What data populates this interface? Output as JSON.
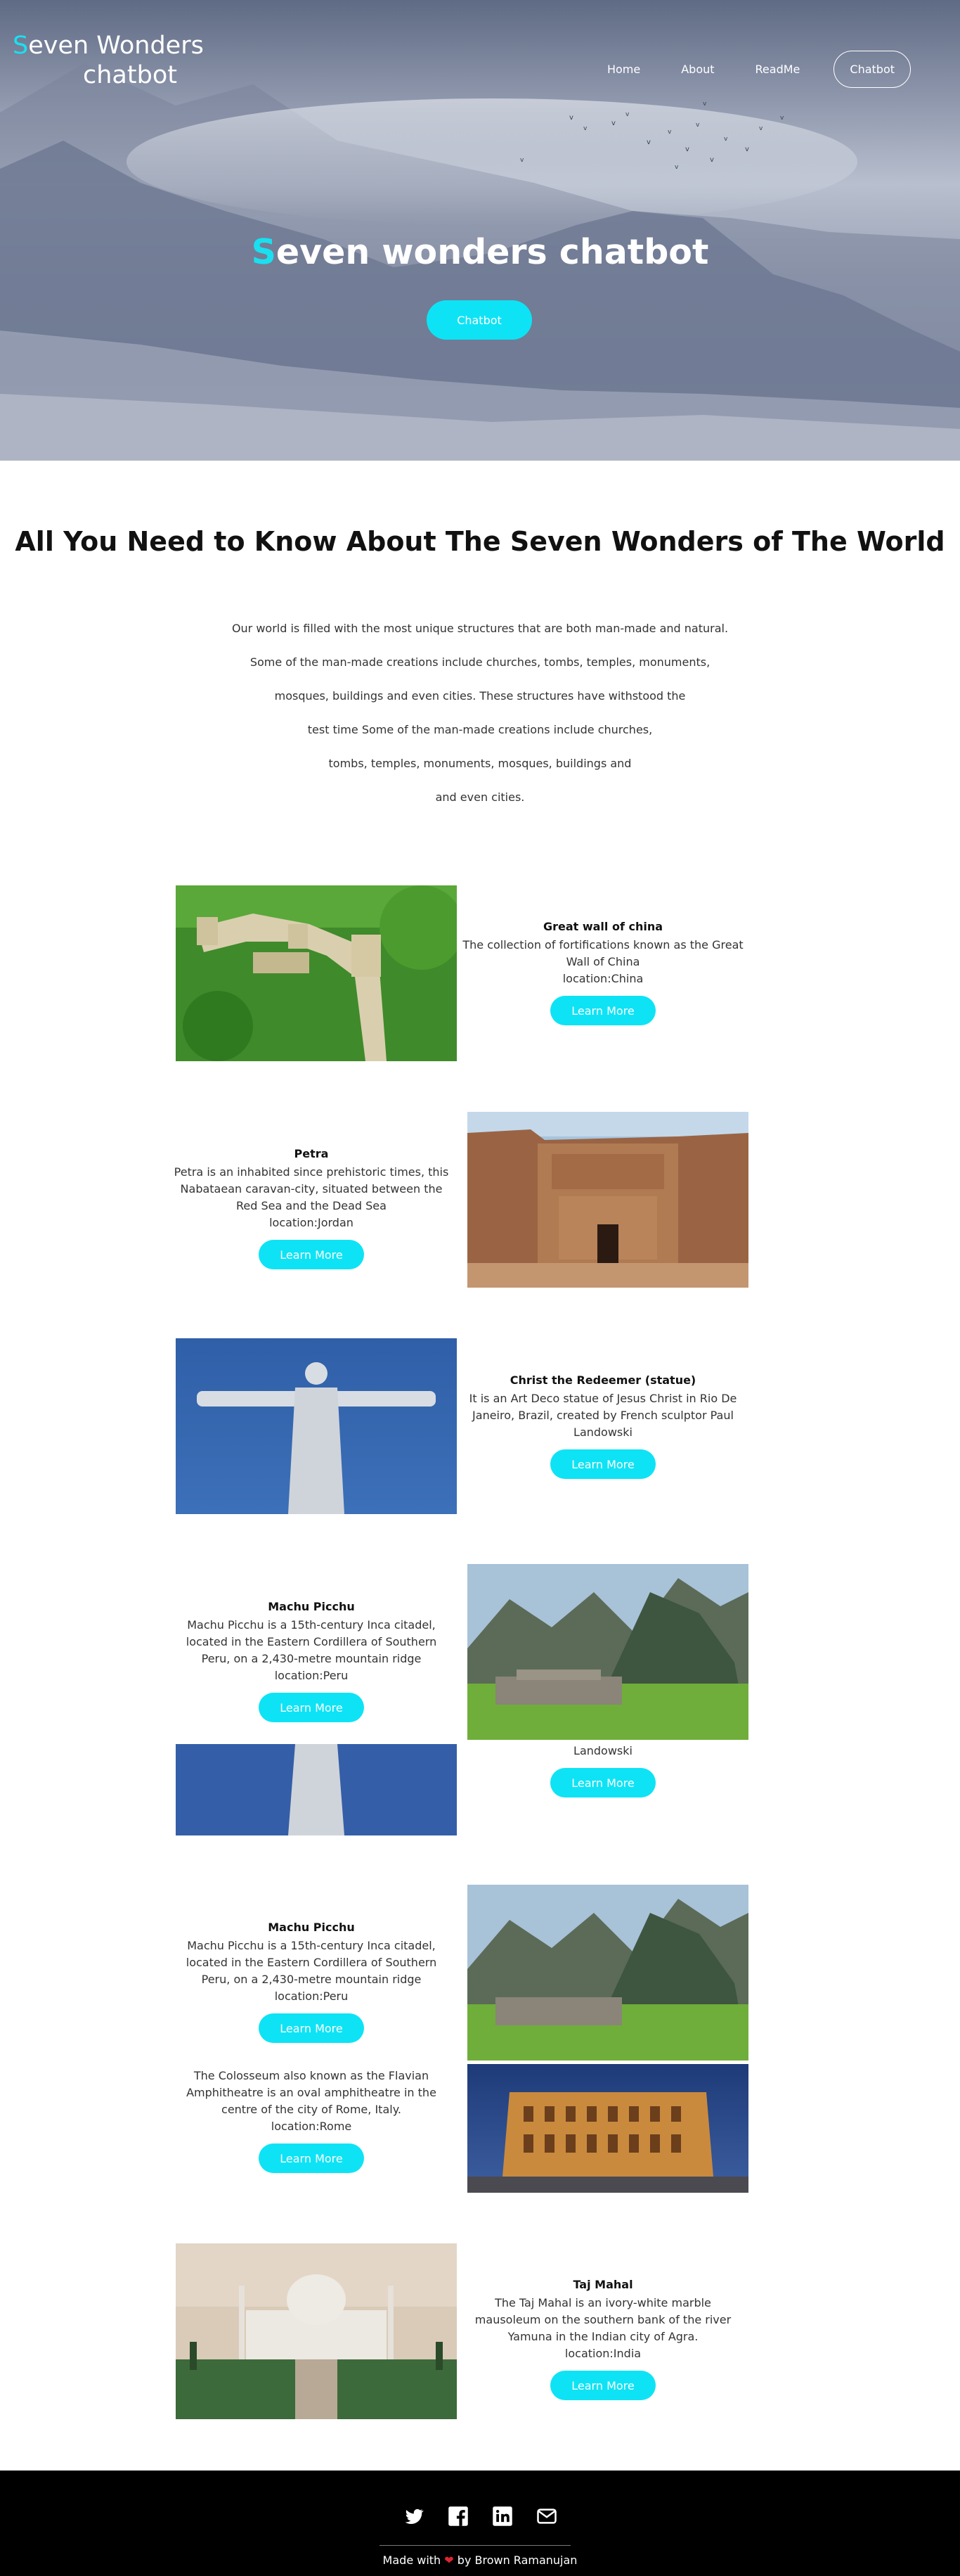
{
  "brand": {
    "accent": "S",
    "line1_rest": "even Wonders",
    "line2": "chatbot"
  },
  "nav": {
    "home": "Home",
    "about": "About",
    "readme": "ReadMe",
    "chatbot": "Chatbot"
  },
  "hero": {
    "title_accent": "S",
    "title_rest": "even wonders chatbot",
    "button": "Chatbot"
  },
  "intro": {
    "title": "All You Need to Know About The Seven Wonders of The World",
    "lines": [
      "Our world is filled with the most unique structures that are both man-made and natural.",
      "Some of the man-made creations include churches, tombs, temples, monuments,",
      "mosques, buildings and even cities. These structures have withstood the",
      "test time Some of the man-made creations include churches,",
      "tombs, temples, monuments, mosques, buildings and",
      "and even cities."
    ]
  },
  "learn_more": "Learn More",
  "wonders": {
    "great_wall": {
      "title": "Great wall of china",
      "desc": "The collection of fortifications known as the Great Wall of China",
      "loc": "location:China"
    },
    "petra": {
      "title": "Petra",
      "desc": "Petra is an inhabited since prehistoric times, this Nabataean caravan-city, situated between the Red Sea and the Dead Sea",
      "loc": "location:Jordan"
    },
    "christ": {
      "title": "Christ the Redeemer (statue)",
      "desc": "It is an Art Deco statue of Jesus Christ in Rio De Janeiro, Brazil, created by French sculptor Paul Landowski"
    },
    "machu1": {
      "title": "Machu Picchu",
      "desc": "Machu Picchu is a 15th-century Inca citadel, located in the Eastern Cordillera of Southern Peru, on a 2,430-metre mountain ridge",
      "loc": "location:Peru"
    },
    "overlap_text": "Landowski",
    "machu2": {
      "title": "Machu Picchu",
      "desc": "Machu Picchu is a 15th-century Inca citadel, located in the Eastern Cordillera of Southern Peru, on a 2,430-metre mountain ridge",
      "loc": "location:Peru"
    },
    "colosseum": {
      "desc": "The Colosseum also known as the Flavian Amphitheatre is an oval amphitheatre in the centre of the city of Rome, Italy.",
      "loc": "location:Rome"
    },
    "taj": {
      "title": "Taj Mahal",
      "desc": "The Taj Mahal is an ivory-white marble mausoleum on the southern bank of the river Yamuna in the Indian city of Agra.",
      "loc": "location:India"
    }
  },
  "footer": {
    "icons": [
      "twitter-icon",
      "facebook-icon",
      "linkedin-icon",
      "mail-icon"
    ],
    "made_with": "Made with",
    "by": "by Brown Ramanujan"
  },
  "colors": {
    "accent": "#19e0f0",
    "button": "#0ee3f5",
    "footer_bg": "#000000"
  }
}
